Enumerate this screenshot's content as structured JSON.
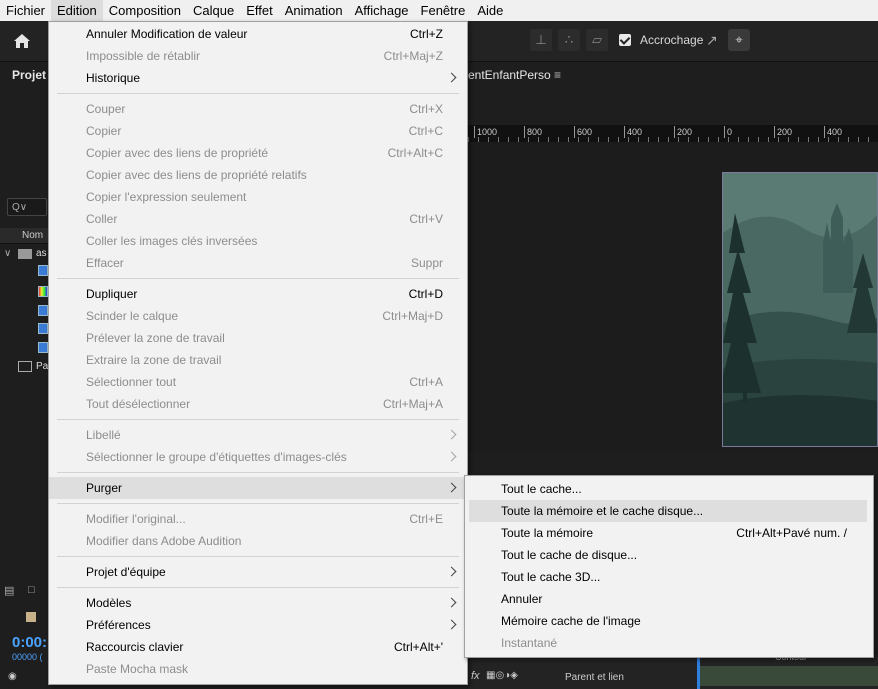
{
  "menubar": [
    "Fichier",
    "Edition",
    "Composition",
    "Calque",
    "Effet",
    "Animation",
    "Affichage",
    "Fenêtre",
    "Aide"
  ],
  "toolbar": {
    "snap_label": "Accrochage"
  },
  "panels": {
    "project_tab": "Projet",
    "comp_tab": "entEnfantPerso",
    "search": "Q∨",
    "column_name": "Nom",
    "tree_folder": "as",
    "tree_item": "Pa",
    "timecode": "0:00:",
    "framecode": "00000 (",
    "parent_link": "Parent et lien",
    "right_label": "Contour"
  },
  "ruler": [
    "1000",
    "800",
    "600",
    "400",
    "200",
    "0",
    "200",
    "400"
  ],
  "edit_menu": {
    "items": [
      {
        "label": "Annuler Modification de valeur",
        "shortcut": "Ctrl+Z",
        "enabled": true
      },
      {
        "label": "Impossible de rétablir",
        "shortcut": "Ctrl+Maj+Z",
        "enabled": false
      },
      {
        "label": "Historique",
        "shortcut": "",
        "enabled": true,
        "submenu": true
      },
      {
        "label": "Couper",
        "shortcut": "Ctrl+X",
        "enabled": false
      },
      {
        "label": "Copier",
        "shortcut": "Ctrl+C",
        "enabled": false
      },
      {
        "label": "Copier avec des liens de propriété",
        "shortcut": "Ctrl+Alt+C",
        "enabled": false
      },
      {
        "label": "Copier avec des liens de propriété relatifs",
        "shortcut": "",
        "enabled": false
      },
      {
        "label": "Copier l'expression seulement",
        "shortcut": "",
        "enabled": false
      },
      {
        "label": "Coller",
        "shortcut": "Ctrl+V",
        "enabled": false
      },
      {
        "label": "Coller les images clés inversées",
        "shortcut": "",
        "enabled": false
      },
      {
        "label": "Effacer",
        "shortcut": "Suppr",
        "enabled": false
      },
      {
        "label": "Dupliquer",
        "shortcut": "Ctrl+D",
        "enabled": true
      },
      {
        "label": "Scinder le calque",
        "shortcut": "Ctrl+Maj+D",
        "enabled": false
      },
      {
        "label": "Prélever la zone de travail",
        "shortcut": "",
        "enabled": false
      },
      {
        "label": "Extraire la zone de travail",
        "shortcut": "",
        "enabled": false
      },
      {
        "label": "Sélectionner tout",
        "shortcut": "Ctrl+A",
        "enabled": false
      },
      {
        "label": "Tout désélectionner",
        "shortcut": "Ctrl+Maj+A",
        "enabled": false
      },
      {
        "label": "Libellé",
        "shortcut": "",
        "enabled": false,
        "submenu": true
      },
      {
        "label": "Sélectionner le groupe d'étiquettes d'images-clés",
        "shortcut": "",
        "enabled": false,
        "submenu": true
      },
      {
        "label": "Purger",
        "shortcut": "",
        "enabled": true,
        "submenu": true,
        "highlighted": true
      },
      {
        "label": "Modifier l'original...",
        "shortcut": "Ctrl+E",
        "enabled": false
      },
      {
        "label": "Modifier dans Adobe Audition",
        "shortcut": "",
        "enabled": false
      },
      {
        "label": "Projet d'équipe",
        "shortcut": "",
        "enabled": true,
        "submenu": true
      },
      {
        "label": "Modèles",
        "shortcut": "",
        "enabled": true,
        "submenu": true
      },
      {
        "label": "Préférences",
        "shortcut": "",
        "enabled": true,
        "submenu": true
      },
      {
        "label": "Raccourcis clavier",
        "shortcut": "Ctrl+Alt+'",
        "enabled": true
      },
      {
        "label": "Paste Mocha mask",
        "shortcut": "",
        "enabled": false
      }
    ]
  },
  "purge_menu": {
    "items": [
      {
        "label": "Tout le cache...",
        "shortcut": "",
        "enabled": true
      },
      {
        "label": "Toute la mémoire et le cache disque...",
        "shortcut": "",
        "enabled": true,
        "highlighted": true
      },
      {
        "label": "Toute la mémoire",
        "shortcut": "Ctrl+Alt+Pavé num. /",
        "enabled": true
      },
      {
        "label": "Tout le cache de disque...",
        "shortcut": "",
        "enabled": true
      },
      {
        "label": "Tout le cache 3D...",
        "shortcut": "",
        "enabled": true
      },
      {
        "label": "Annuler",
        "shortcut": "",
        "enabled": true
      },
      {
        "label": "Mémoire cache de l'image",
        "shortcut": "",
        "enabled": true
      },
      {
        "label": "Instantané",
        "shortcut": "",
        "enabled": false
      }
    ]
  }
}
